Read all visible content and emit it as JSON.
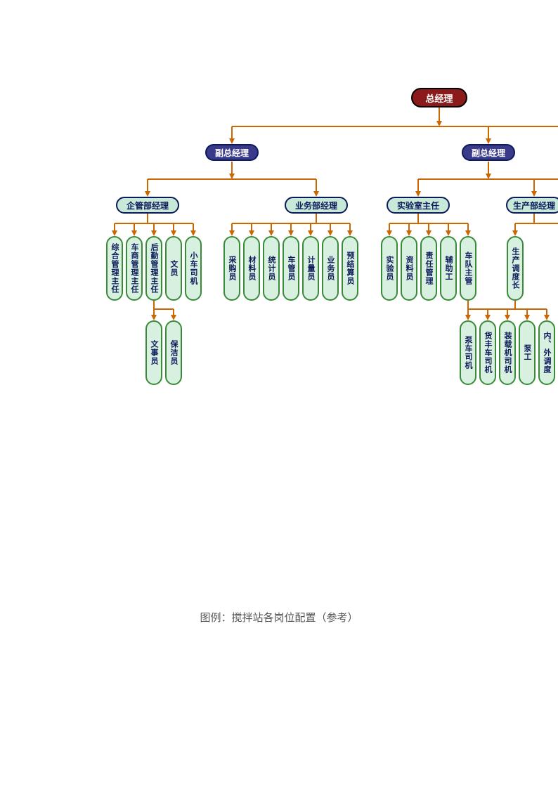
{
  "caption": "图例：搅拌站各岗位配置（参考）",
  "root": "总经理",
  "deputies": [
    "副总经理",
    "副总经理"
  ],
  "managers": [
    "企管部经理",
    "业务部经理",
    "实验室主任",
    "生产部经理"
  ],
  "leaves_row1": {
    "group1": [
      "综合管理主任",
      "车商管理主任",
      "后勤管理主任",
      "文员",
      "小车司机"
    ],
    "group2": [
      "采购员",
      "材料员",
      "统计员",
      "车管员",
      "计量员",
      "业务员",
      "预结算员"
    ],
    "group3": [
      "实验员",
      "资料员",
      "责任管理",
      "辅助工",
      "车队主管"
    ],
    "group4": [
      "生产调度长"
    ]
  },
  "leaves_row2": {
    "under_admin": [
      "文事员",
      "保洁员"
    ],
    "under_fleet": [
      "泵车司机",
      "货丰车司机",
      "装载机司机",
      "泵工",
      "内、外调度"
    ]
  }
}
